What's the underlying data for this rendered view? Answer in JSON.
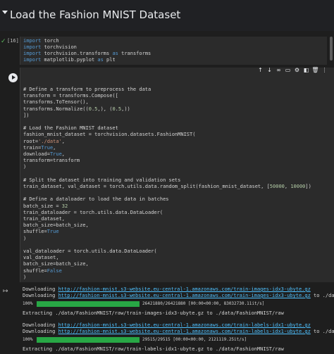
{
  "header": {
    "title": "Load the Fashion MNIST Dataset"
  },
  "cell1": {
    "exec_count": "[16]",
    "lines": [
      "import torch",
      "import torchvision",
      "import torchvision.transforms as transforms",
      "import matplotlib.pyplot as plt"
    ]
  },
  "toolbar": {
    "icons": [
      "arrow-up-icon",
      "arrow-down-icon",
      "link-icon",
      "comment-icon",
      "settings-icon",
      "mirror-icon",
      "delete-icon",
      "more-icon"
    ]
  },
  "cell2": {
    "lines": [
      "# Define a transform to preprocess the data",
      "transform = transforms.Compose([",
      "    transforms.ToTensor(),",
      "    transforms.Normalize((0.5,), (0.5,))",
      "])",
      "",
      "# Load the Fashion MNIST dataset",
      "fashion_mnist_dataset = torchvision.datasets.FashionMNIST(",
      "    root='./data',",
      "    train=True,",
      "    download=True,",
      "    transform=transform",
      ")",
      "",
      "# Split the dataset into training and validation sets",
      "train_dataset, val_dataset = torch.utils.data.random_split(fashion_mnist_dataset, [50000, 10000])",
      "",
      "# Define a dataloader to load the data in batches",
      "batch_size = 32",
      "train_dataloader = torch.utils.data.DataLoader(",
      "    train_dataset,",
      "    batch_size=batch_size,",
      "    shuffle=True",
      ")",
      "",
      "val_dataloader = torch.utils.data.DataLoader(",
      "    val_dataset,",
      "    batch_size=batch_size,",
      "    shuffle=False",
      ")"
    ]
  },
  "output": {
    "download1_prefix": "Downloading ",
    "download1_url": "http://fashion-mnist.s3-website.eu-central-1.amazonaws.com/train-images-idx3-ubyte.gz",
    "download2_prefix": "Downloading ",
    "download2_url": "http://fashion-mnist.s3-website.eu-central-1.amazonaws.com/train-images-idx3-ubyte.gz",
    "download2_suffix": " to ./data/",
    "progress1": {
      "pct": "100%",
      "fraction": 1.0,
      "text": "26421880/26421880 [00:00<00:00, 83032730.11it/s]"
    },
    "extract1": "Extracting ./data/FashionMNIST/raw/train-images-idx3-ubyte.gz to ./data/FashionMNIST/raw",
    "download3_prefix": "Downloading ",
    "download3_url": "http://fashion-mnist.s3-website.eu-central-1.amazonaws.com/train-labels-idx1-ubyte.gz",
    "download4_prefix": "Downloading ",
    "download4_url": "http://fashion-mnist.s3-website.eu-central-1.amazonaws.com/train-labels-idx1-ubyte.gz",
    "download4_suffix": " to ./data/",
    "progress2": {
      "pct": "100%",
      "fraction": 1.0,
      "text": "29515/29515 [00:00<00:00, 2121119.25it/s]"
    },
    "extract2": "Extracting ./data/FashionMNIST/raw/train-labels-idx1-ubyte.gz to ./data/FashionMNIST/raw"
  }
}
